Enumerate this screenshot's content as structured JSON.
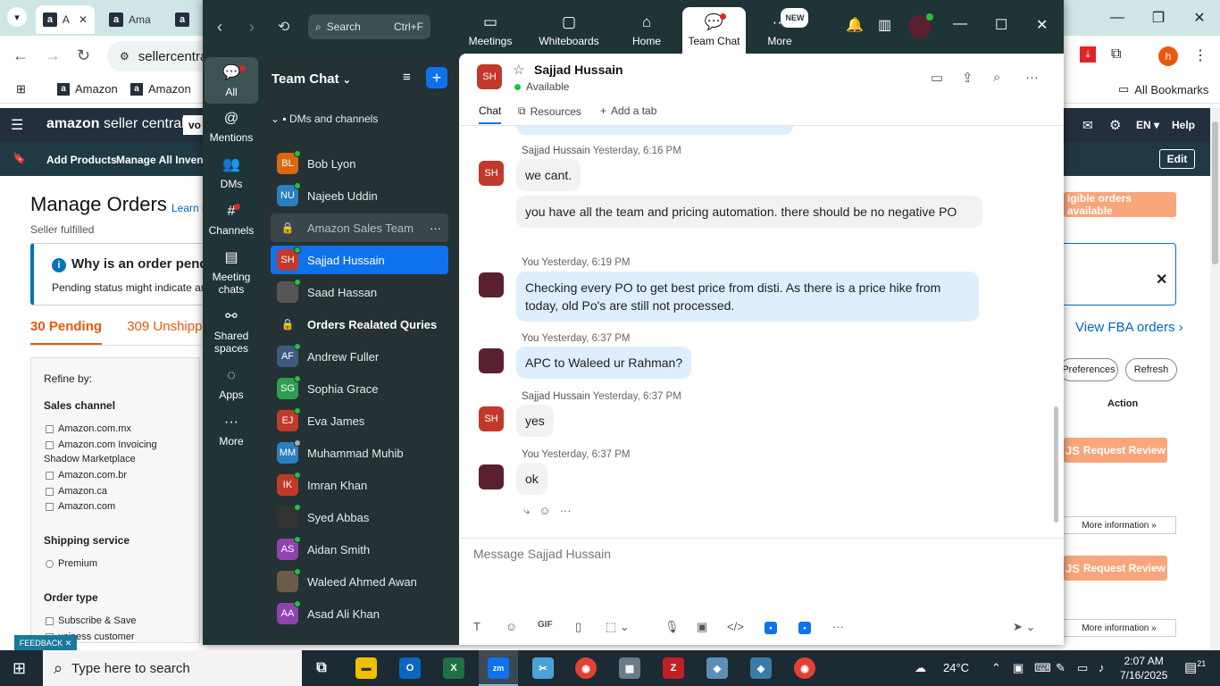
{
  "browser": {
    "tabs": [
      {
        "label": "A"
      },
      {
        "label": "Ama"
      },
      {
        "label": ""
      }
    ],
    "url": "sellercentra",
    "bookmarks": [
      "Amazon",
      "Amazon"
    ],
    "all_bookmarks": "All Bookmarks",
    "profile_initial": "h"
  },
  "seller": {
    "logo": "amazon",
    "logo_suffix": "seller central",
    "search_partial": "vo",
    "header_right": {
      "lang": "EN",
      "help": "Help"
    },
    "subnav": [
      "Add Products",
      "Manage All Inventor"
    ],
    "edit": "Edit",
    "page_title": "Manage Orders",
    "learn_more": "Learn n",
    "subtitle": "Seller fulfilled",
    "info_title": "Why is an order pendi",
    "info_text": "Pending status might indicate an",
    "pending_tab": "30 Pending",
    "unshipped_tab": "309 Unshippe",
    "view_fba": "View FBA orders",
    "eligible_orders": "igible orders available",
    "preferences": "Preferences",
    "refresh": "Refresh",
    "action_col": "Action",
    "request_review": "Request Review",
    "more_information": "More information",
    "refine": {
      "title": "Refine by:",
      "sales_channel": "Sales channel",
      "channels": [
        "Amazon.com.mx",
        "Amazon.com Invoicing",
        "Shadow Marketplace",
        "Amazon.com.br",
        "Amazon.ca",
        "Amazon.com"
      ],
      "shipping_service": "Shipping service",
      "premium": "Premium",
      "order_type": "Order type",
      "order_types": [
        "Subscribe & Save",
        "usiness customer"
      ]
    },
    "feedback": "FEEDBACK"
  },
  "zoom": {
    "search_label": "Search",
    "search_shortcut": "Ctrl+F",
    "top_tabs": [
      "Meetings",
      "Whiteboards",
      "Home",
      "Team Chat",
      "More"
    ],
    "new_badge": "NEW",
    "rail": [
      "All",
      "Mentions",
      "DMs",
      "Channels",
      "Meeting chats",
      "Shared spaces",
      "Apps",
      "More"
    ],
    "list_header": "Team Chat",
    "section": "DMs and channels",
    "contacts": [
      {
        "name": "Bob Lyon",
        "initials": "BL",
        "color": "#d9680e",
        "type": "dm"
      },
      {
        "name": "Najeeb Uddin",
        "initials": "NU",
        "color": "#2a7fbf",
        "type": "dm"
      },
      {
        "name": "Amazon Sales Team",
        "initials": "",
        "color": "",
        "type": "channel"
      },
      {
        "name": "Sajjad Hussain",
        "initials": "SH",
        "color": "#c0392b",
        "type": "dm"
      },
      {
        "name": "Saad Hassan",
        "initials": "",
        "color": "#555555",
        "type": "dm"
      },
      {
        "name": "Orders Realated Quries",
        "initials": "",
        "color": "",
        "type": "channel"
      },
      {
        "name": "Andrew Fuller",
        "initials": "AF",
        "color": "#3d5a80",
        "type": "dm"
      },
      {
        "name": "Sophia Grace",
        "initials": "SG",
        "color": "#2e9e4f",
        "type": "dm"
      },
      {
        "name": "Eva James",
        "initials": "EJ",
        "color": "#c0392b",
        "type": "dm"
      },
      {
        "name": "Muhammad Muhib",
        "initials": "MM",
        "color": "#2a7fbf",
        "type": "dm"
      },
      {
        "name": "Imran Khan",
        "initials": "IK",
        "color": "#c0392b",
        "type": "dm"
      },
      {
        "name": "Syed Abbas",
        "initials": "",
        "color": "#333333",
        "type": "dm"
      },
      {
        "name": "Aidan Smith",
        "initials": "AS",
        "color": "#8e44ad",
        "type": "dm"
      },
      {
        "name": "Waleed Ahmed Awan",
        "initials": "",
        "color": "#6b5b4b",
        "type": "dm"
      },
      {
        "name": "Asad Ali Khan",
        "initials": "AA",
        "color": "#8e44ad",
        "type": "dm"
      }
    ],
    "chat": {
      "name": "Sajjad Hussain",
      "initials": "SH",
      "status": "Available",
      "tabs": [
        "Chat",
        "Resources",
        "Add a tab"
      ],
      "messages": [
        {
          "sender": "Sajjad Hussain",
          "time": "Yesterday, 6:16 PM",
          "text": "we cant.",
          "dir": "in"
        },
        {
          "sender": "",
          "time": "",
          "text": "you have all the team and pricing automation. there should be no negative PO",
          "dir": "in"
        },
        {
          "sender": "You",
          "time": "Yesterday, 6:19 PM",
          "text": "Checking every PO to get best price from disti. As there is a price hike from today, old Po's are still not processed.",
          "dir": "out"
        },
        {
          "sender": "You",
          "time": "Yesterday, 6:37 PM",
          "text": "APC to Waleed ur Rahman?",
          "dir": "out"
        },
        {
          "sender": "Sajjad Hussain",
          "time": "Yesterday, 6:37 PM",
          "text": "yes",
          "dir": "in"
        },
        {
          "sender": "You",
          "time": "Yesterday, 6:37 PM",
          "text": "ok",
          "dir": "in"
        }
      ],
      "compose_placeholder": "Message Sajjad Hussain"
    }
  },
  "taskbar": {
    "search": "Type here to search",
    "temperature": "24°C",
    "time": "2:07 AM",
    "date": "7/16/2025",
    "notifications": "21"
  }
}
